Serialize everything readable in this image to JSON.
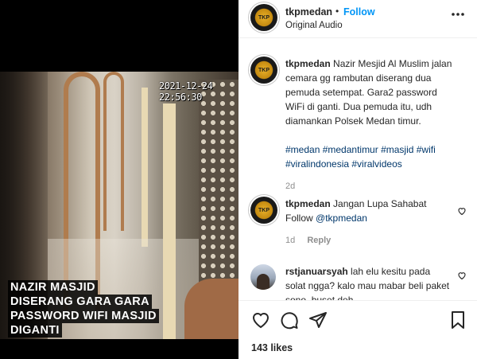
{
  "post": {
    "timestamp": "2021-12-24 22:56:30",
    "overlay_lines": [
      "NAZIR MASJID",
      "DISERANG GARA GARA",
      "PASSWORD WIFI MASJID",
      "DIGANTI"
    ]
  },
  "header": {
    "username": "tkpmedan",
    "separator": "•",
    "follow_label": "Follow",
    "audio_label": "Original Audio",
    "more_icon": "more-horizontal-icon"
  },
  "caption": {
    "username": "tkpmedan",
    "text": "Nazir Mesjid Al Muslim jalan cemara gg rambutan diserang dua pemuda setempat. Gara2 password WiFi di ganti. Dua pemuda itu, udh diamankan Polsek Medan timur.",
    "hashtags": "#medan #medantimur #masjid #wifi #viralindonesia #viralvideos",
    "age": "2d"
  },
  "comments": [
    {
      "username": "tkpmedan",
      "text": "Jangan Lupa Sahabat Follow",
      "mention": "@tkpmedan",
      "age": "1d",
      "reply_label": "Reply"
    },
    {
      "username": "rstjanuarsyah",
      "text": "lah elu kesitu pada solat ngga? kalo mau mabar beli paket sono, buset deh"
    }
  ],
  "actions": {
    "icons": [
      "heart-icon",
      "comment-icon",
      "share-icon",
      "bookmark-icon"
    ],
    "likes": "143 likes"
  },
  "colors": {
    "follow": "#0095f6",
    "link": "#00376b",
    "muted": "#8e8e8e",
    "text": "#262626"
  }
}
